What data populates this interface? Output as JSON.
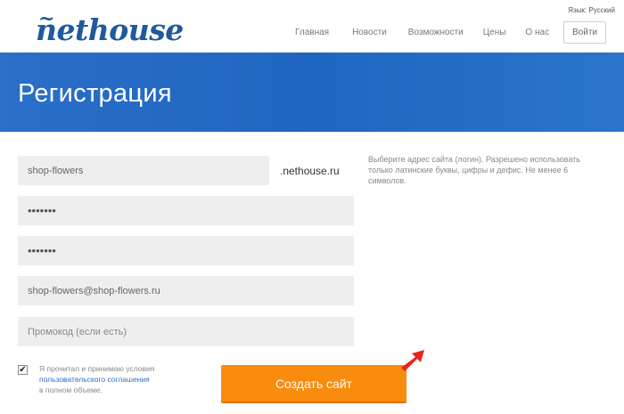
{
  "header": {
    "logo_text": "nethouse",
    "language": "Язык: Русский",
    "nav": [
      "Главная",
      "Новости",
      "Возможности",
      "Цены",
      "О нас"
    ],
    "login_label": "Войти"
  },
  "banner": {
    "title": "Регистрация"
  },
  "form": {
    "login_value": "shop-flowers",
    "domain_suffix": ".nethouse.ru",
    "login_hint": "Выберите адрес сайта (логин). Разрешено использовать только латинские буквы, цифры и дефис. Не менее 6 символов.",
    "password_value": "•••••••",
    "password_confirm_value": "•••••••",
    "email_value": "shop-flowers@shop-flowers.ru",
    "promo_placeholder": "Промокод (если есть)",
    "agree_text_1": "Я прочитал и принимаю условия",
    "agree_link": "пользовательского соглашения",
    "agree_text_2": "в полном объеме.",
    "agree_checked": true,
    "submit_label": "Создать сайт"
  },
  "colors": {
    "brand_blue": "#1e5a9c",
    "banner_blue": "#2a6fc8",
    "accent_orange": "#f98b0d",
    "arrow_red": "#e8241b"
  },
  "icons": {
    "checkbox": "check-icon",
    "pointer": "red-arrow-icon"
  }
}
